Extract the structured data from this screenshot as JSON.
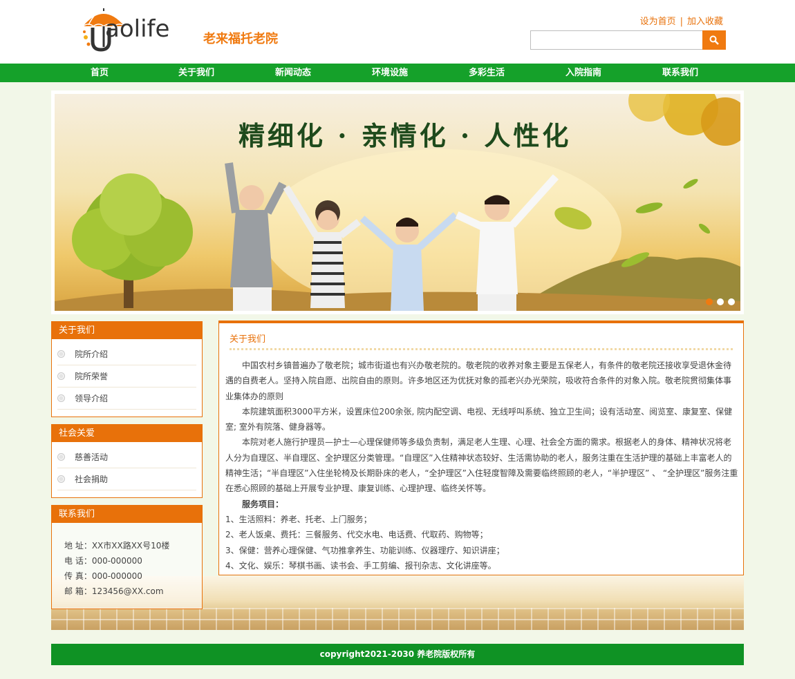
{
  "header": {
    "logo_text": "aolife",
    "site_name": "老来福托老院",
    "set_homepage": "设为首页",
    "separator": "|",
    "add_favorite": "加入收藏",
    "search_placeholder": ""
  },
  "nav": {
    "items": [
      "首页",
      "关于我们",
      "新闻动态",
      "环境设施",
      "多彩生活",
      "入院指南",
      "联系我们"
    ]
  },
  "banner": {
    "slogan": "精细化 · 亲情化 · 人性化",
    "slides": 3,
    "active_slide": 1
  },
  "sidebar": {
    "about": {
      "title": "关于我们",
      "items": [
        "院所介绍",
        "院所荣誉",
        "领导介绍"
      ]
    },
    "social": {
      "title": "社会关爱",
      "items": [
        "慈善活动",
        "社会捐助"
      ]
    },
    "contact": {
      "title": "联系我们",
      "address": "地 址：XX市XX路XX号10楼",
      "phone": "电 话：000-000000",
      "fax": "传 真：000-000000",
      "email": "邮 箱：123456@XX.com"
    }
  },
  "main": {
    "title": "关于我们",
    "paragraphs": [
      "中国农村乡镇普遍办了敬老院；城市街道也有兴办敬老院的。敬老院的收养对象主要是五保老人，有条件的敬老院还接收享受退休金待遇的自费老人。坚持入院自愿、出院自由的原则。许多地区还为优抚对象的孤老兴办光荣院，吸收符合条件的对象入院。敬老院贯彻集体事业集体办的原则",
      "本院建筑面积3000平方米，设置床位200余张, 院内配空调、电视、无线呼叫系统、独立卫生间；设有活动室、阅览室、康复室、保健室; 室外有院落、健身器等。",
      "本院对老人施行护理员—护士—心理保健师等多级负责制，满足老人生理、心理、社会全方面的需求。根据老人的身体、精神状况将老人分为自理区、半自理区、全护理区分类管理。“自理区”入住精神状态较好、生活需协助的老人，服务注重在生活护理的基础上丰富老人的精神生活；“半自理区”入住坐轮椅及长期卧床的老人，“全护理区”入住轻度智障及需要临终照顾的老人，“半护理区” 、 “全护理区”服务注重在悉心照顾的基础上开展专业护理、康复训练、心理护理、临终关怀等。"
    ],
    "services_heading": "服务项目：",
    "services": [
      "1、生活照料：养老、托老、上门服务；",
      "2、老人饭桌、费托：三餐服务、代交水电、电话费、代取药、购物等；",
      "3、保健：营养心理保健、气功推拿养生、功能训练、仪器理疗、知识讲座；",
      "4、文化、娱乐：琴棋书画、读书会、手工剪编、报刊杂志、文化讲座等。"
    ]
  },
  "footer": {
    "copyright": "copyright2021-2030 养老院版权所有"
  },
  "colors": {
    "green": "#15a12a",
    "orange": "#e8710a",
    "footer_green": "#0f9224"
  }
}
